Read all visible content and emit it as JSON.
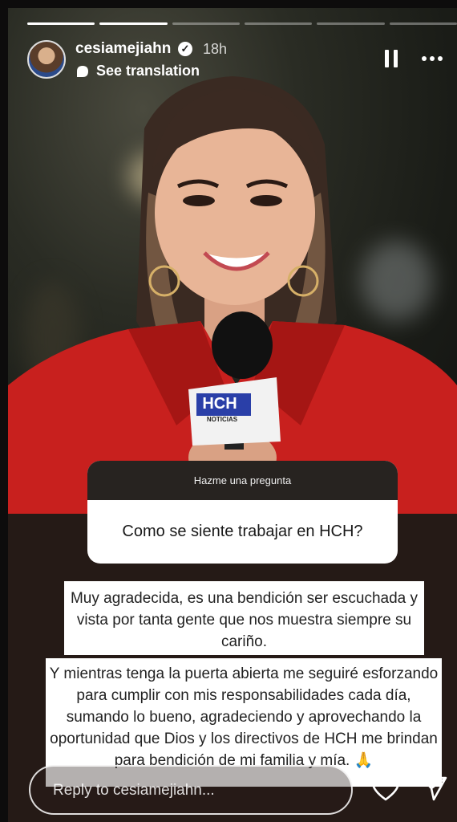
{
  "header": {
    "username": "cesiamejiahn",
    "time": "18h",
    "see_translation": "See translation",
    "progress_total": 6,
    "progress_done": 2
  },
  "question": {
    "title": "Hazme una pregunta",
    "text": "Como se siente trabajar en HCH?"
  },
  "answers": [
    "Muy agradecida, es una bendición ser escuchada y vista por tanta gente que nos muestra siempre su cariño.",
    "Y mientras tenga la puerta abierta me seguiré esforzando para cumplir con mis responsabilidades cada día, sumando lo bueno, agradeciendo y aprovechando la oportunidad que Dios y los directivos de HCH me brindan para bendición de mi familia y mía. 🙏"
  ],
  "photo": {
    "mic_label": "HCH",
    "mic_sub": "NOTICIAS"
  },
  "reply": {
    "placeholder": "Reply to cesiamejiahn..."
  },
  "colors": {
    "jacket": "#c8201e",
    "mic_blue": "#2a3fa8"
  }
}
